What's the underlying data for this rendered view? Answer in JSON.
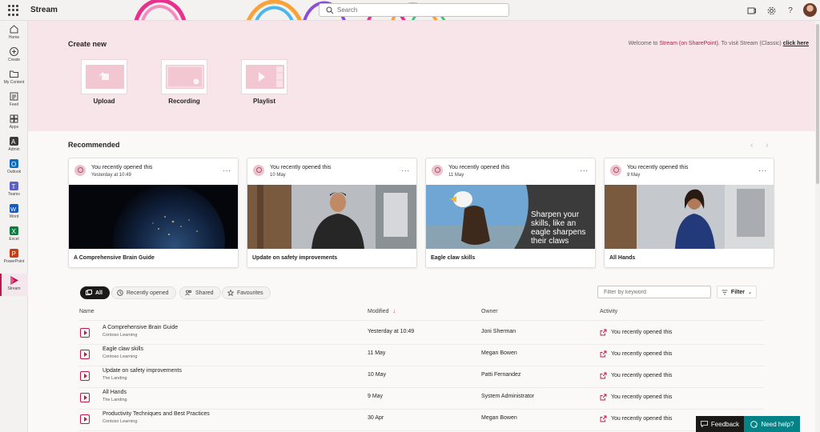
{
  "app": {
    "title": "Stream"
  },
  "search": {
    "placeholder": "Search"
  },
  "rail": {
    "items": [
      {
        "label": "Home",
        "icon": "home-icon"
      },
      {
        "label": "Create",
        "icon": "create-icon"
      },
      {
        "label": "My Content",
        "icon": "folder-icon"
      },
      {
        "label": "Feed",
        "icon": "feed-icon"
      },
      {
        "label": "Apps",
        "icon": "apps-icon"
      },
      {
        "label": "Admin",
        "icon": "admin-icon"
      },
      {
        "label": "Outlook",
        "icon": "outlook-icon"
      },
      {
        "label": "Teams",
        "icon": "teams-icon"
      },
      {
        "label": "Word",
        "icon": "word-icon"
      },
      {
        "label": "Excel",
        "icon": "excel-icon"
      },
      {
        "label": "PowerPoint",
        "icon": "powerpoint-icon"
      },
      {
        "label": "Stream",
        "icon": "stream-icon"
      }
    ]
  },
  "create": {
    "title": "Create new",
    "upload": "Upload",
    "recording": "Recording",
    "playlist": "Playlist"
  },
  "welcome": {
    "prefix": "Welcome to ",
    "stream_sp": "Stream (on SharePoint)",
    "middle": ". To visit Stream (Classic) ",
    "link": "click here"
  },
  "recommended": {
    "title": "Recommended",
    "cards": [
      {
        "header": "You recently opened this",
        "time": "Yesterday at 10:49",
        "title": "A Comprehensive Brain Guide",
        "more": "..."
      },
      {
        "header": "You recently opened this",
        "time": "10 May",
        "title": "Update on safety improvements",
        "more": "..."
      },
      {
        "header": "You recently opened this",
        "time": "11 May",
        "title": "Eagle claw skills",
        "more": "...",
        "overlay": "Sharpen your skills, like an eagle sharpens their claws"
      },
      {
        "header": "You recently opened this",
        "time": "9 May",
        "title": "All Hands",
        "more": "..."
      }
    ]
  },
  "filters": {
    "all": "All",
    "recent": "Recently opened",
    "shared": "Shared",
    "favourites": "Favourites",
    "keyword_placeholder": "Filter by keyword",
    "filter_btn": "Filter"
  },
  "table": {
    "columns": {
      "name": "Name",
      "modified": "Modified",
      "owner": "Owner",
      "activity": "Activity"
    },
    "rows": [
      {
        "name": "A Comprehensive Brain Guide",
        "location": "Contoso Learning",
        "modified": "Yesterday at 10:49",
        "owner": "Joni Sherman",
        "activity": "You recently opened this"
      },
      {
        "name": "Eagle claw skills",
        "location": "Contoso Learning",
        "modified": "11 May",
        "owner": "Megan Bowen",
        "activity": "You recently opened this"
      },
      {
        "name": "Update on safety improvements",
        "location": "The Landing",
        "modified": "10 May",
        "owner": "Patti Fernandez",
        "activity": "You recently opened this"
      },
      {
        "name": "All Hands",
        "location": "The Landing",
        "modified": "9 May",
        "owner": "System Administrator",
        "activity": "You recently opened this"
      },
      {
        "name": "Productivity Techniques and Best Practices",
        "location": "Contoso Learning",
        "modified": "30 Apr",
        "owner": "Megan Bowen",
        "activity": "You recently opened this"
      }
    ]
  },
  "help": {
    "feedback": "Feedback",
    "needhelp": "Need help?"
  },
  "colors": {
    "accent": "#bc1948",
    "hero_bg": "#f8e5ea",
    "help_teal": "#038387"
  }
}
